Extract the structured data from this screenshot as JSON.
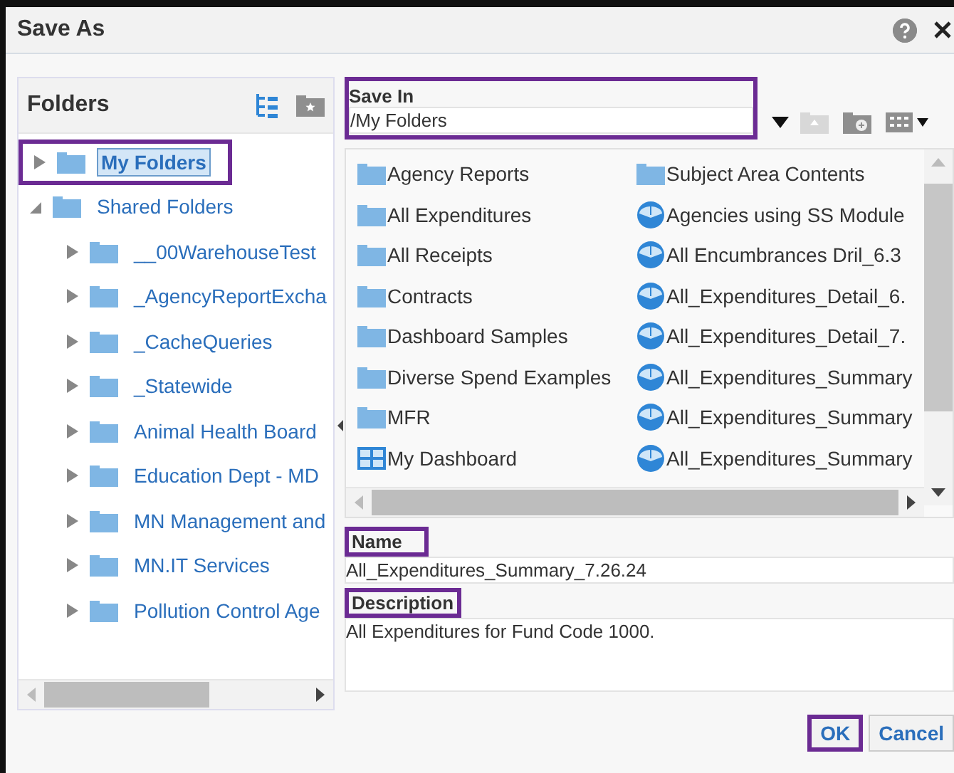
{
  "window": {
    "title": "Save As"
  },
  "folders_panel": {
    "title": "Folders"
  },
  "tree": [
    {
      "label": "My Folders",
      "expanded": false,
      "selected": true,
      "highlighted": true
    },
    {
      "label": "Shared Folders",
      "expanded": true,
      "selected": false,
      "highlighted": false,
      "children": [
        {
          "label": "__00WarehouseTest",
          "expanded": false,
          "selected": false,
          "highlighted": false
        },
        {
          "label": "_AgencyReportExcha",
          "expanded": false,
          "selected": false,
          "highlighted": false
        },
        {
          "label": "_CacheQueries",
          "expanded": false,
          "selected": false,
          "highlighted": false
        },
        {
          "label": "_Statewide",
          "expanded": false,
          "selected": false,
          "highlighted": false
        },
        {
          "label": "Animal Health Board",
          "expanded": false,
          "selected": false,
          "highlighted": false
        },
        {
          "label": "Education Dept - MD",
          "expanded": false,
          "selected": false,
          "highlighted": false
        },
        {
          "label": "MN Management and",
          "expanded": false,
          "selected": false,
          "highlighted": false
        },
        {
          "label": "MN.IT Services",
          "expanded": false,
          "selected": false,
          "highlighted": false
        },
        {
          "label": "Pollution Control Age",
          "expanded": false,
          "selected": false,
          "highlighted": false
        }
      ]
    }
  ],
  "save_in": {
    "label": "Save In",
    "value": "/My Folders",
    "highlighted": true
  },
  "items": [
    {
      "label": "Agency Reports",
      "kind": "folder"
    },
    {
      "label": "Subject Area Contents",
      "kind": "folder"
    },
    {
      "label": "All Expenditures",
      "kind": "folder"
    },
    {
      "label": "Agencies using SS Module",
      "kind": "analysis"
    },
    {
      "label": "All Receipts",
      "kind": "folder"
    },
    {
      "label": "All Encumbrances Dril_6.3",
      "kind": "analysis"
    },
    {
      "label": "Contracts",
      "kind": "folder"
    },
    {
      "label": "All_Expenditures_Detail_6.",
      "kind": "analysis"
    },
    {
      "label": "Dashboard Samples",
      "kind": "folder"
    },
    {
      "label": "All_Expenditures_Detail_7.",
      "kind": "analysis"
    },
    {
      "label": "Diverse Spend Examples",
      "kind": "folder"
    },
    {
      "label": "All_Expenditures_Summary",
      "kind": "analysis"
    },
    {
      "label": "MFR",
      "kind": "folder"
    },
    {
      "label": "All_Expenditures_Summary",
      "kind": "analysis"
    },
    {
      "label": "My Dashboard",
      "kind": "dashboard"
    },
    {
      "label": "All_Expenditures_Summary",
      "kind": "analysis"
    }
  ],
  "name": {
    "label": "Name",
    "value": "All_Expenditures_Summary_7.26.24",
    "highlighted": true
  },
  "description": {
    "label": "Description",
    "value": "All Expenditures for Fund Code 1000.",
    "highlighted": true
  },
  "buttons": [
    {
      "label": "OK",
      "highlighted": true
    },
    {
      "label": "Cancel",
      "highlighted": false
    }
  ]
}
